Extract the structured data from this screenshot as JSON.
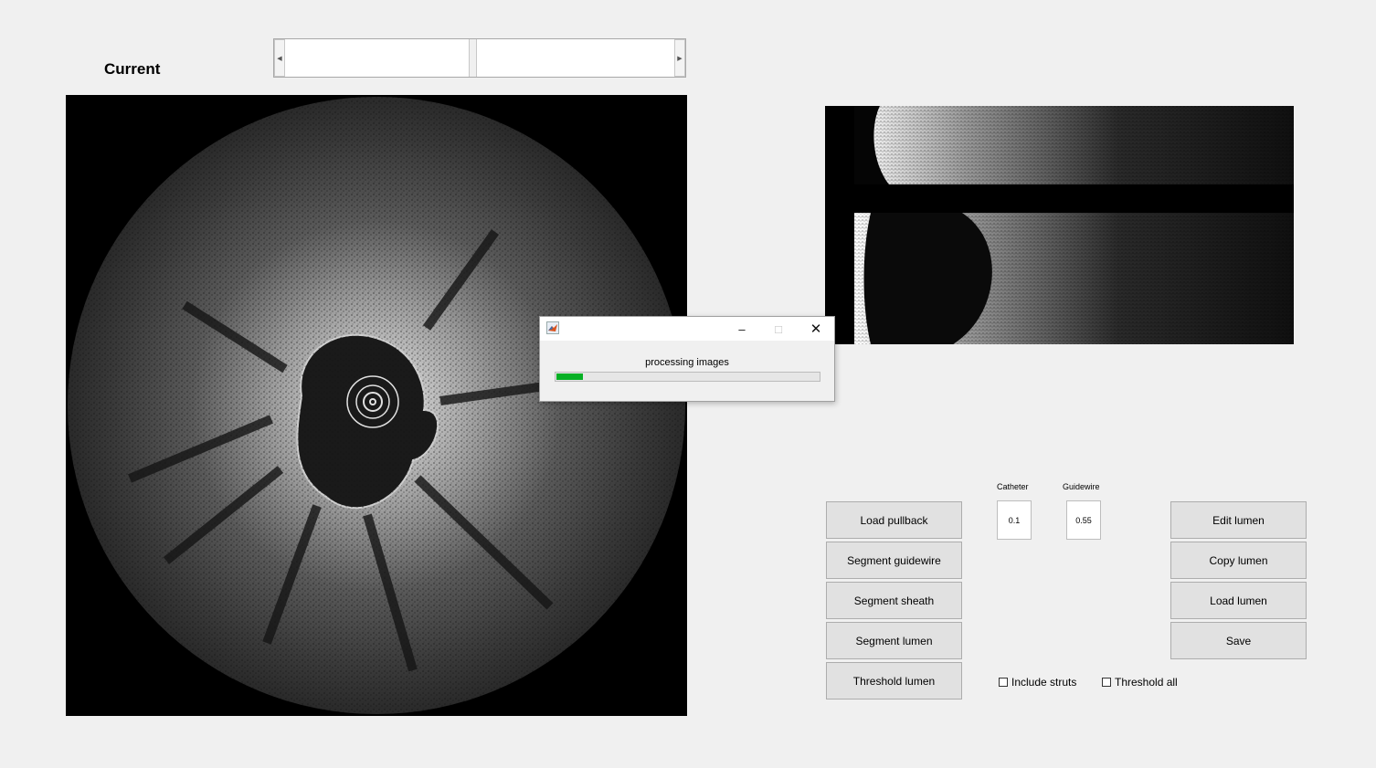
{
  "header": {
    "current_label": "Current"
  },
  "slider": {
    "left_arrow_icon": "left-arrow-icon",
    "right_arrow_icon": "right-arrow-icon"
  },
  "progress_dialog": {
    "message": "processing images",
    "progress": 0.1,
    "progress_color": "#06b025",
    "minimize_glyph": "–",
    "maximize_glyph": "□",
    "close_glyph": "✕",
    "app_icon": "matlab-icon"
  },
  "left_buttons": [
    {
      "label": "Load pullback"
    },
    {
      "label": "Segment guidewire"
    },
    {
      "label": "Segment sheath"
    },
    {
      "label": "Segment lumen"
    },
    {
      "label": "Threshold lumen"
    }
  ],
  "right_buttons": [
    {
      "label": "Edit lumen"
    },
    {
      "label": "Copy lumen"
    },
    {
      "label": "Load lumen"
    },
    {
      "label": "Save"
    }
  ],
  "params": {
    "catheter_label": "Catheter",
    "catheter_value": "0.1",
    "guidewire_label": "Guidewire",
    "guidewire_value": "0.55"
  },
  "checkboxes": {
    "include_struts": {
      "label": "Include struts",
      "checked": false
    },
    "threshold_all": {
      "label": "Threshold all",
      "checked": false
    }
  }
}
